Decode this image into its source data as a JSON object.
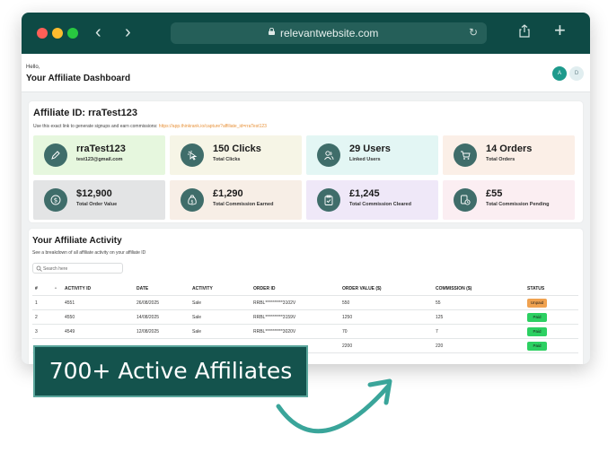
{
  "browser": {
    "url": "relevantwebsite.com",
    "buttons": {
      "back": "‹",
      "forward": "›",
      "reload": "↻",
      "new_tab": "+"
    }
  },
  "header": {
    "greeting": "Hello,",
    "title": "Your Affiliate Dashboard",
    "avatar_primary": "A",
    "avatar_secondary": "D"
  },
  "affiliate": {
    "id_label": "Affiliate ID: rraTest123",
    "link_prompt": "Use this exact link to generate signups and earn commissions:",
    "link_url": "https://app.thinkrank.io/capture?affiliate_id=rraTest123"
  },
  "stats": [
    {
      "main": "rraTest123",
      "sub": "test123@gmail.com",
      "icon": "pencil-icon",
      "bg": "#e6f7de"
    },
    {
      "main": "150 Clicks",
      "sub": "Total Clicks",
      "icon": "click-icon",
      "bg": "#f6f5e6"
    },
    {
      "main": "29 Users",
      "sub": "Linked Users",
      "icon": "users-icon",
      "bg": "#e3f6f4"
    },
    {
      "main": "14 Orders",
      "sub": "Total Orders",
      "icon": "cart-icon",
      "bg": "#fbefe7"
    },
    {
      "main": "$12,900",
      "sub": "Total Order Value",
      "icon": "dollar-icon",
      "bg": "#e3e4e5"
    },
    {
      "main": "£1,290",
      "sub": "Total Commission Earned",
      "icon": "money-bag-icon",
      "bg": "#f7eee6"
    },
    {
      "main": "£1,245",
      "sub": "Total Commission Cleared",
      "icon": "clipboard-check-icon",
      "bg": "#efe8f8"
    },
    {
      "main": "£55",
      "sub": "Total Commission Pending",
      "icon": "pending-icon",
      "bg": "#fbeef2"
    }
  ],
  "activity": {
    "title": "Your Affiliate Activity",
    "subtitle": "See a breakdown of all affiliate activity on your affiliate ID",
    "search_placeholder": "Search here",
    "columns": [
      "#",
      "ACTIVITY ID",
      "DATE",
      "ACTIVITY",
      "ORDER ID",
      "ORDER VALUE ($)",
      "COMMISSION ($)",
      "STATUS"
    ],
    "rows": [
      {
        "n": "1",
        "activity_id": "4551",
        "date": "26/08/2025",
        "activity": "Sale",
        "order_id": "RRBL**********3102V",
        "order_value": "550",
        "commission": "55",
        "status": "Unpaid"
      },
      {
        "n": "2",
        "activity_id": "4550",
        "date": "14/08/2025",
        "activity": "Sale",
        "order_id": "RRBL**********3159V",
        "order_value": "1250",
        "commission": "125",
        "status": "Paid"
      },
      {
        "n": "3",
        "activity_id": "4549",
        "date": "12/08/2025",
        "activity": "Sale",
        "order_id": "RRBL**********3020V",
        "order_value": "70",
        "commission": "7",
        "status": "Paid"
      },
      {
        "n": "",
        "activity_id": "",
        "date": "",
        "activity": "",
        "order_id": "",
        "order_value": "2200",
        "commission": "220",
        "status": "Paid"
      }
    ]
  },
  "banner": {
    "text": "700+ Active Affiliates"
  },
  "colors": {
    "titlebar": "#0e4a45",
    "accent": "#1e9a8c",
    "unpaid": "#f0a250",
    "paid": "#2cd062",
    "link": "#e8923a"
  }
}
